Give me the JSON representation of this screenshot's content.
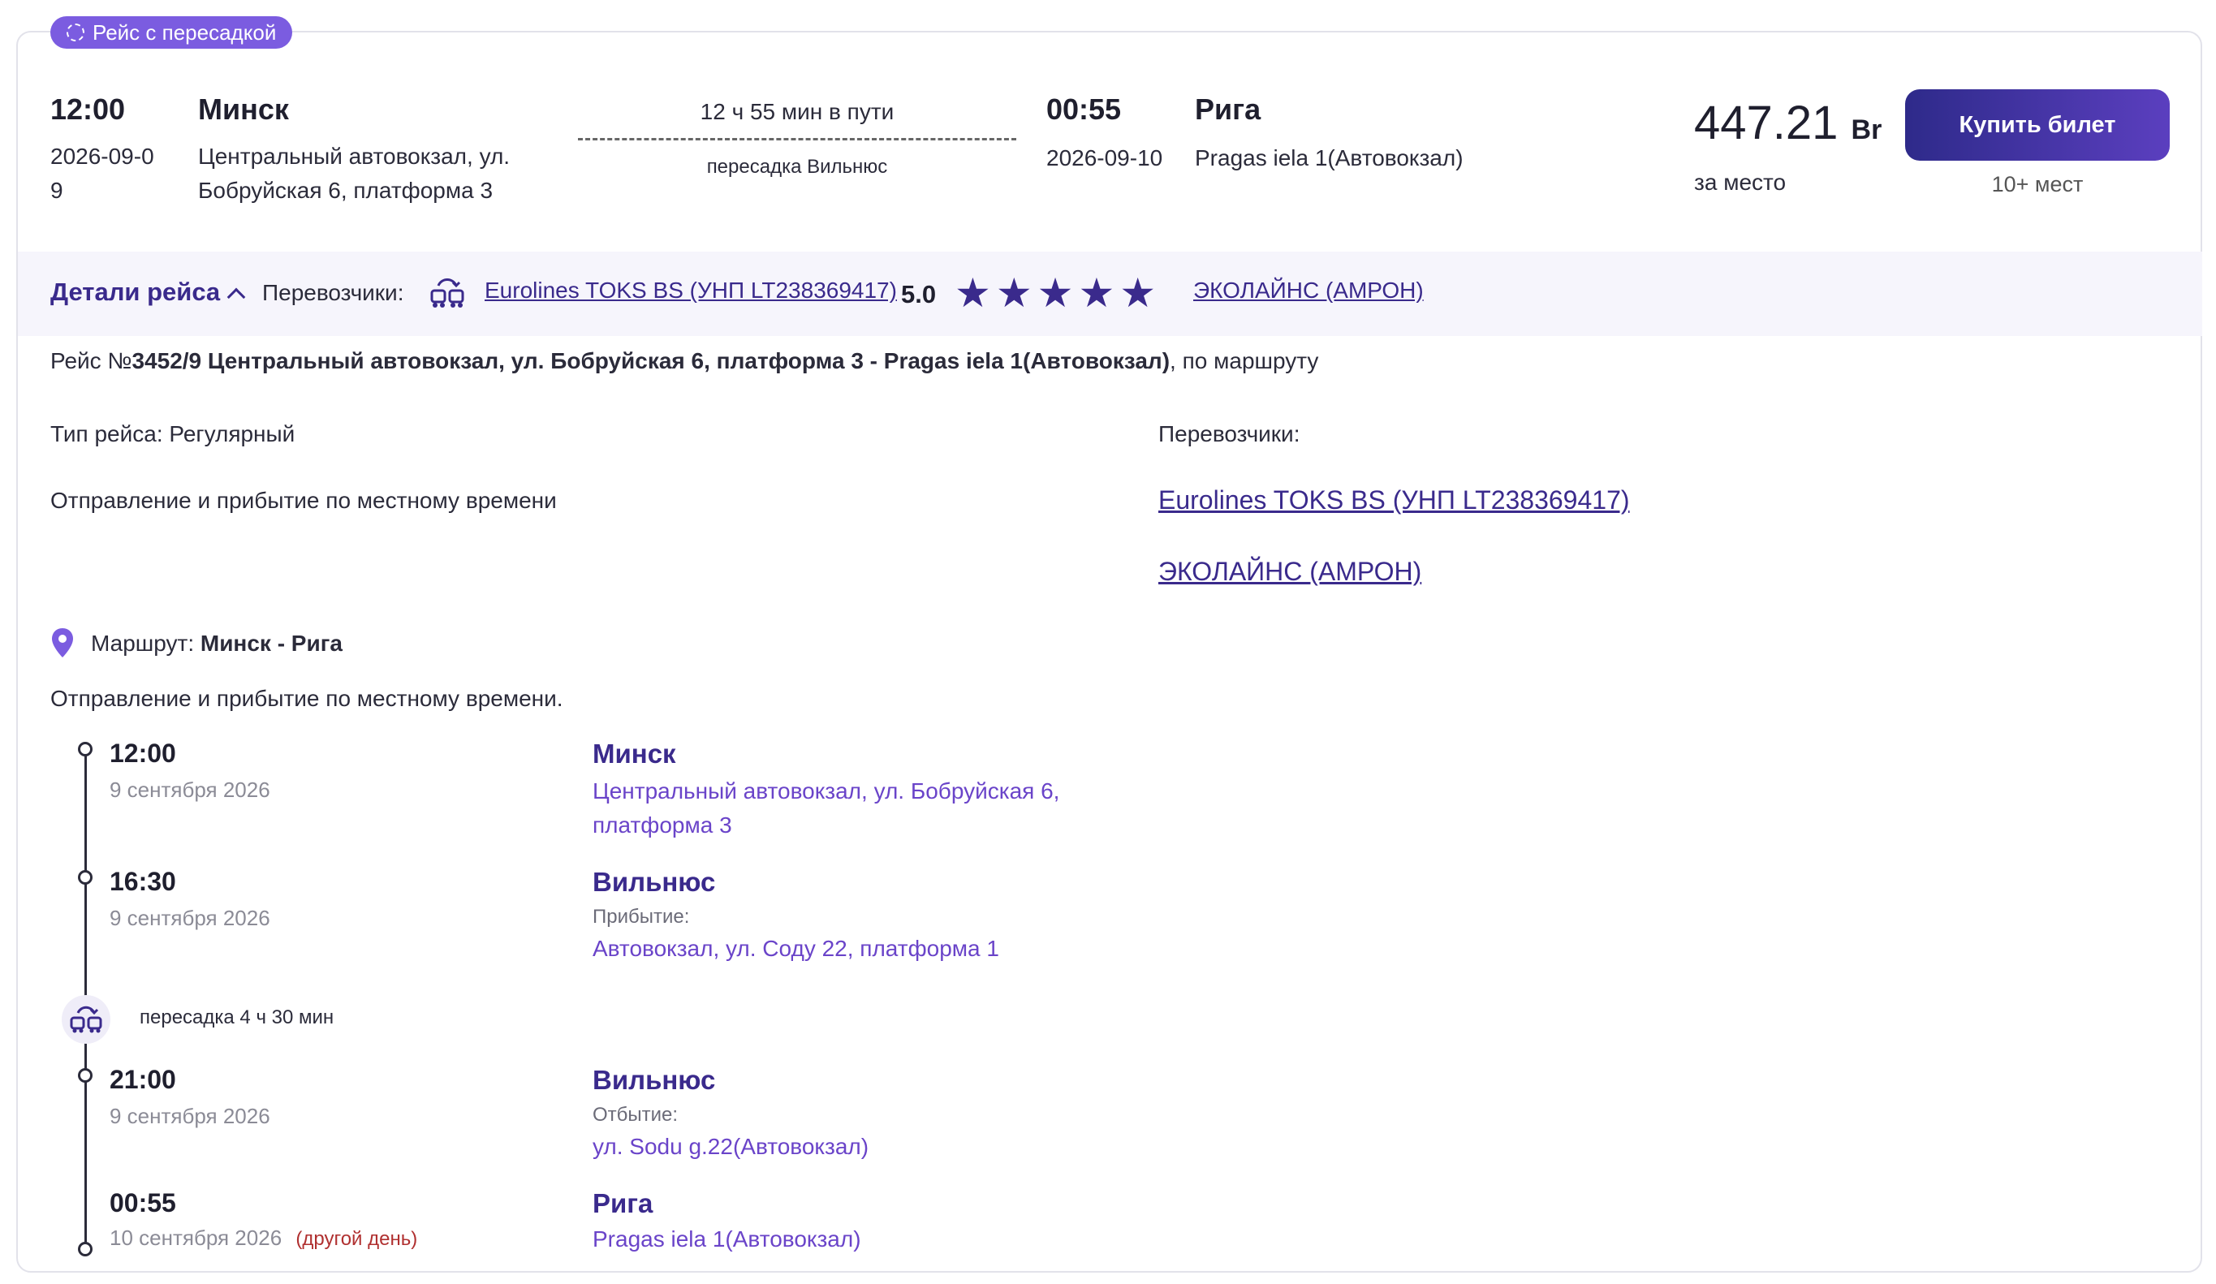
{
  "badge": {
    "label": "Рейс с пересадкой"
  },
  "trip": {
    "dep_time": "12:00",
    "dep_date": "2026-09-09",
    "dep_city": "Минск",
    "dep_station": "Центральный автовокзал, ул. Бобруйская 6, платформа 3",
    "duration": "12 ч 55 мин в пути",
    "transfer": "пересадка Вильнюс",
    "arr_time": "00:55",
    "arr_date": "2026-09-10",
    "arr_city": "Рига",
    "arr_station": "Pragas iela 1(Автовокзал)"
  },
  "price": {
    "amount": "447.21",
    "currency": "Br",
    "per": "за место"
  },
  "buy": {
    "label": "Купить билет",
    "seats": "10+ мест"
  },
  "details_bar": {
    "toggle_label": "Детали рейса",
    "carriers_label": "Перевозчики:",
    "carrier_1": "Eurolines TOKS BS (УНП LT238369417)",
    "rating": "5.0",
    "stars": "★★★★★",
    "carrier_2": "ЭКОЛАЙНС (АМРОН)"
  },
  "details": {
    "route_prefix": "Рейс №",
    "route_bold": "3452/9 Центральный автовокзал, ул. Бобруйская 6, платформа 3 - Pragas iela 1(Автовокзал)",
    "route_suffix": ", по маршруту",
    "type_label": "Тип рейса: Регулярный",
    "local_time_note": "Отправление и прибытие по местному времени",
    "carriers_label": "Перевозчики:",
    "carrier_1": "Eurolines TOKS BS (УНП LT238369417)",
    "carrier_2": "ЭКОЛАЙНС (АМРОН)"
  },
  "route": {
    "label": "Маршрут:",
    "value": "Минск - Рига",
    "note": "Отправление и прибытие по местному времени."
  },
  "timeline": {
    "stop_1": {
      "time": "12:00",
      "date": "9 сентября 2026",
      "city": "Минск",
      "address": "Центральный автовокзал, ул. Бобруйская 6, платформа 3"
    },
    "stop_2": {
      "time": "16:30",
      "date": "9 сентября 2026",
      "city": "Вильнюс",
      "kind": "Прибытие:",
      "address": "Автовокзал, ул. Соду 22, платформа 1"
    },
    "transfer": "пересадка 4 ч 30 мин",
    "stop_3": {
      "time": "21:00",
      "date": "9 сентября 2026",
      "city": "Вильнюс",
      "kind": "Отбытие:",
      "address": "ул. Sodu g.22(Автовокзал)"
    },
    "stop_4": {
      "time": "00:55",
      "date": "10 сентября 2026",
      "next_day": "(другой день)",
      "city": "Рига",
      "address": "Pragas iela 1(Автовокзал)"
    }
  },
  "colors": {
    "accent": "#3a2a8c",
    "badge": "#7b5ce0",
    "link": "#6a44c9",
    "warning": "#b03030"
  }
}
